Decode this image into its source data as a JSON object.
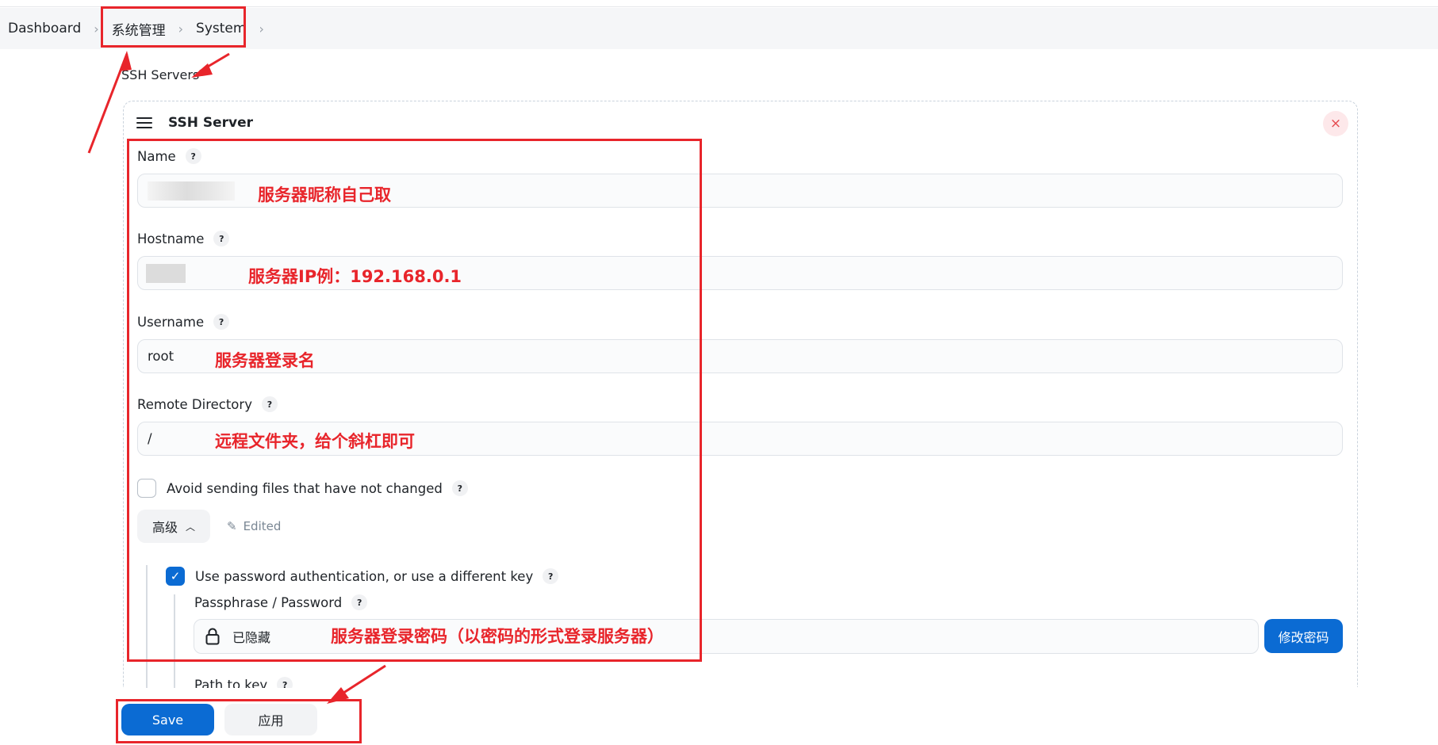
{
  "breadcrumb": {
    "items": [
      "Dashboard",
      "系统管理",
      "System"
    ],
    "separator": "›"
  },
  "section": {
    "title": "SSH Servers"
  },
  "card": {
    "title": "SSH Server",
    "close_symbol": "×"
  },
  "fields": {
    "name": {
      "label": "Name",
      "value": ""
    },
    "hostname": {
      "label": "Hostname",
      "value": ""
    },
    "username": {
      "label": "Username",
      "value": "root"
    },
    "remote_directory": {
      "label": "Remote Directory",
      "value": "/"
    }
  },
  "help_symbol": "?",
  "avoid_sending": {
    "label": "Avoid sending files that have not changed",
    "checked": false
  },
  "advanced": {
    "label": "高级",
    "edited_label": "Edited"
  },
  "password_auth": {
    "label": "Use password authentication, or use a different key",
    "checked": true
  },
  "passphrase": {
    "label": "Passphrase / Password",
    "value": "已隐藏",
    "change_button": "修改密码"
  },
  "path_to_key": {
    "label": "Path to key"
  },
  "actions": {
    "save": "Save",
    "apply": "应用"
  },
  "annotations": {
    "name": "服务器昵称自己取",
    "hostname": "服务器IP例：192.168.0.1",
    "username": "服务器登录名",
    "remote_directory": "远程文件夹，给个斜杠即可",
    "password": "服务器登录密码（以密码的形式登录服务器）"
  },
  "colors": {
    "accent": "#0b6bd3",
    "annotation": "#e8252b",
    "close": "#e5484d"
  }
}
